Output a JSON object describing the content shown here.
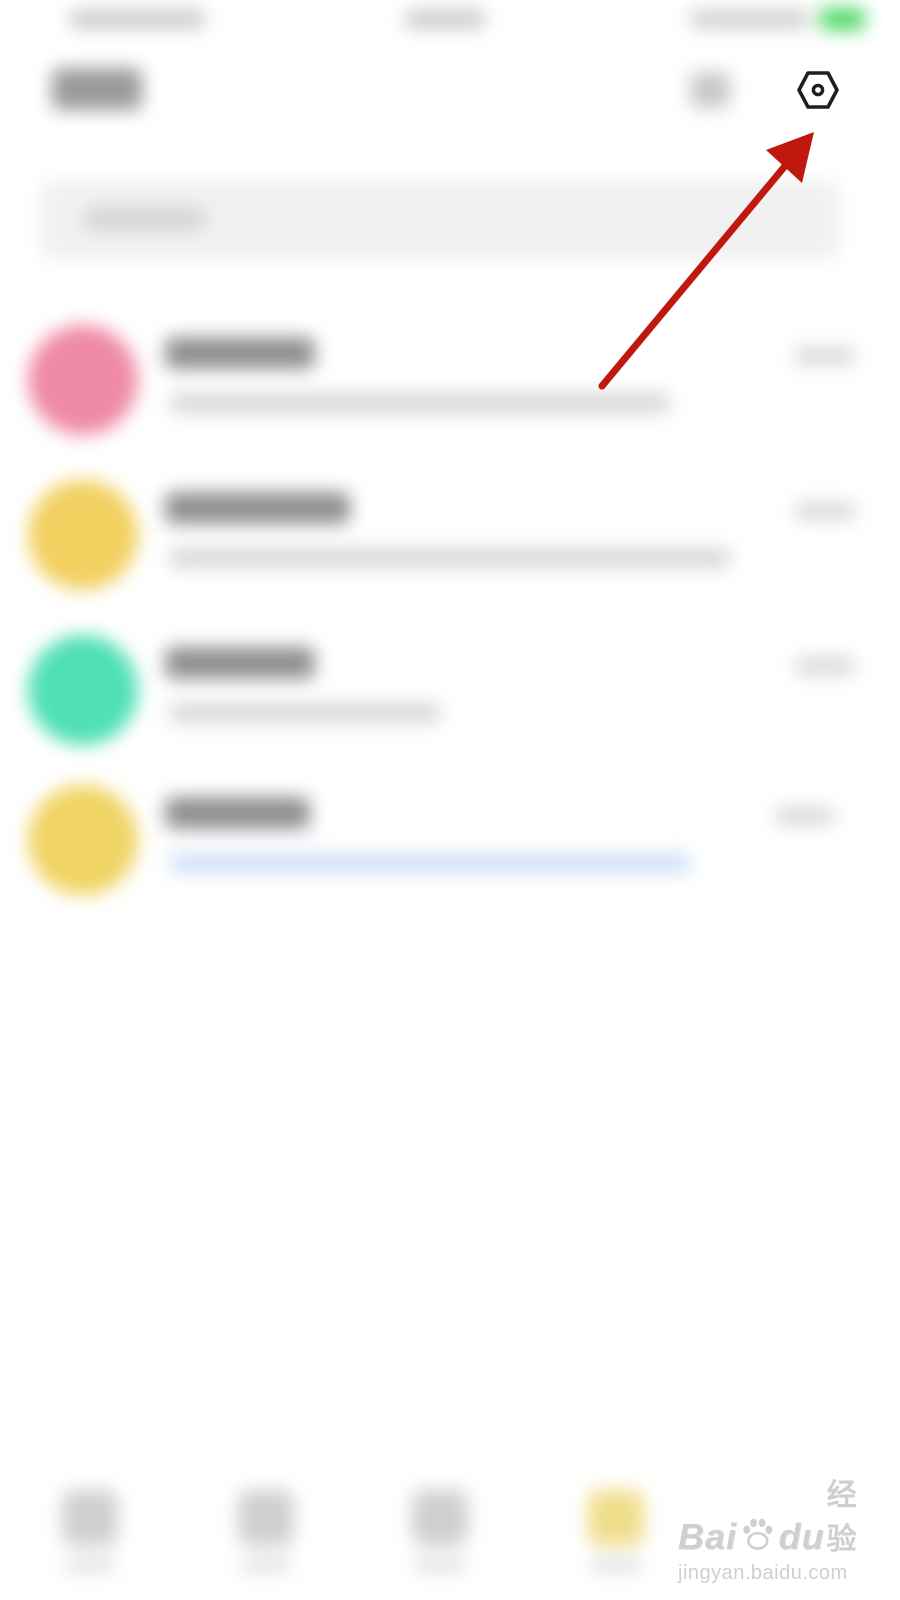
{
  "settings_icon": "gear-icon",
  "annotation": {
    "type": "arrow",
    "color": "#c0180f"
  },
  "avatar_colors": [
    "#ef8aa6",
    "#f2d060",
    "#4fe0b4",
    "#f0d464"
  ],
  "tab_highlight_color": "#f0dd8c",
  "watermark": {
    "brand": "Bai",
    "brand_suffix": "du",
    "cn": "经验",
    "url": "jingyan.baidu.com"
  }
}
